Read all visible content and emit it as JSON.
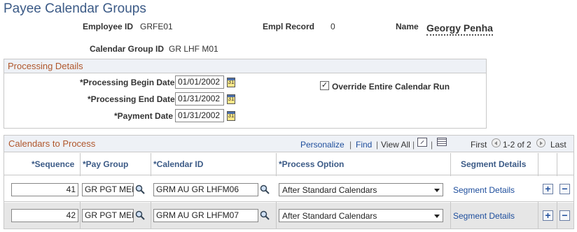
{
  "page": {
    "title": "Payee Calendar Groups"
  },
  "header": {
    "employee_id_label": "Employee ID",
    "employee_id": "GRFE01",
    "empl_record_label": "Empl Record",
    "empl_record": "0",
    "name_label": "Name",
    "name": "Georgy Penha",
    "calendar_group_label": "Calendar Group ID",
    "calendar_group_id": "GR LHF M01"
  },
  "processing": {
    "section_title": "Processing Details",
    "begin_label": "*Processing Begin Date",
    "begin_date": "01/01/2002",
    "end_label": "*Processing End Date",
    "end_date": "01/31/2002",
    "payment_label": "*Payment Date",
    "payment_date": "01/31/2002",
    "override_label": "Override Entire Calendar Run",
    "override_checked": true,
    "calendar_icon_glyph": "31"
  },
  "calendars": {
    "section_title": "Calendars to Process",
    "personalize": "Personalize",
    "find": "Find",
    "view_all": "View All",
    "separator": "|",
    "first": "First",
    "range": "1-2 of 2",
    "last": "Last",
    "columns": {
      "sequence": "*Sequence",
      "pay_group": "*Pay Group",
      "calendar_id": "*Calendar ID",
      "process_option": "*Process Option",
      "segment_details": "Segment Details"
    },
    "rows": [
      {
        "sequence": "41",
        "pay_group": "GR PGT MEN",
        "calendar_id": "GRM AU GR LHFM06",
        "process_option": "After Standard Calendars",
        "segment_link": "Segment Details"
      },
      {
        "sequence": "42",
        "pay_group": "GR PGT MEN",
        "calendar_id": "GRM AU GR LHFM07",
        "process_option": "After Standard Calendars",
        "segment_link": "Segment Details"
      }
    ],
    "add_glyph": "+",
    "remove_glyph": "−"
  },
  "icons": [
    "calendar-icon",
    "checkbox-icon",
    "search-icon",
    "zoom-icon",
    "download-grid-icon",
    "prev-arrow-icon",
    "next-arrow-icon",
    "plus-icon",
    "minus-icon"
  ]
}
